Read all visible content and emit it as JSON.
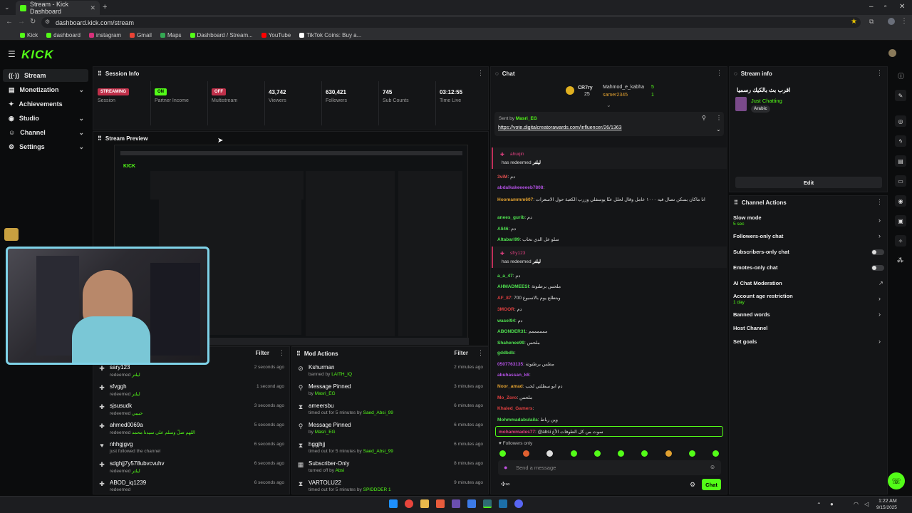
{
  "browser": {
    "tab_title": "Stream - Kick Dashboard",
    "url": "dashboard.kick.com/stream",
    "bookmarks": [
      "Kick",
      "dashboard",
      "instagram",
      "Gmail",
      "Maps",
      "Dashboard / Stream...",
      "YouTube",
      "TikTok Coins: Buy a..."
    ]
  },
  "app": {
    "logo": "KICK"
  },
  "sidebar": {
    "items": [
      {
        "label": "Stream"
      },
      {
        "label": "Monetization"
      },
      {
        "label": "Achievements"
      },
      {
        "label": "Studio"
      },
      {
        "label": "Channel"
      },
      {
        "label": "Settings"
      }
    ]
  },
  "session": {
    "title": "Session Info",
    "stats": [
      {
        "value": "STREAMING",
        "label": "Session"
      },
      {
        "value": "ON",
        "label": "Partner Income"
      },
      {
        "value": "OFF",
        "label": "Multistream"
      },
      {
        "value": "43,742",
        "label": "Viewers"
      },
      {
        "value": "630,421",
        "label": "Followers"
      },
      {
        "value": "745",
        "label": "Sub Counts"
      },
      {
        "value": "03:12:55",
        "label": "Time Live"
      }
    ]
  },
  "preview": {
    "title": "Stream Preview"
  },
  "activity": {
    "filter": "Filter",
    "rows": [
      {
        "name": "sary123",
        "sub": "redeemed",
        "extra": "ليلتر",
        "time": "2 seconds ago"
      },
      {
        "name": "sfvggh",
        "sub": "redeemed",
        "extra": "ليلتر",
        "time": "1 second ago"
      },
      {
        "name": "sjsusudk",
        "sub": "redeemed",
        "extra": "حبيبي",
        "time": "3 seconds ago"
      },
      {
        "name": "ahmed0069a",
        "sub": "redeemed",
        "extra": "اللهم صلّ وسلم على سيدنا محمد",
        "time": "5 seconds ago"
      },
      {
        "name": "nhhgjgvg",
        "sub": "just followed the channel",
        "extra": "",
        "time": "6 seconds ago"
      },
      {
        "name": "sdghjj7y578ubvcvuhv",
        "sub": "redeemed",
        "extra": "ليلتر",
        "time": "6 seconds ago"
      },
      {
        "name": "ABOD_iq1239",
        "sub": "redeemed",
        "extra": "",
        "time": "6 seconds ago"
      }
    ]
  },
  "mod": {
    "title": "Mod Actions",
    "filter": "Filter",
    "rows": [
      {
        "name": "Kshurman",
        "sub": "banned by",
        "by": "LAITH_IQ",
        "time": "2 minutes ago"
      },
      {
        "name": "Message Pinned",
        "sub": "by",
        "by": "Masri_EG",
        "time": "3 minutes ago"
      },
      {
        "name": "ameersbu",
        "sub": "timed out for 5 minutes by",
        "by": "Saed_Absi_99",
        "time": "6 minutes ago"
      },
      {
        "name": "Message Pinned",
        "sub": "by",
        "by": "Masri_EG",
        "time": "6 minutes ago"
      },
      {
        "name": "hggjhjj",
        "sub": "timed out for 5 minutes by",
        "by": "Saed_Absi_99",
        "time": "6 minutes ago"
      },
      {
        "name": "Subscriber-Only",
        "sub": "turned off by",
        "by": "Absi",
        "time": "8 minutes ago"
      },
      {
        "name": "VARTOLU22",
        "sub": "timed out for 5 minutes by",
        "by": "SPIDDDER 1",
        "time": "9 minutes ago"
      }
    ]
  },
  "chat": {
    "title": "Chat",
    "leaders": [
      {
        "name": "CR7ry",
        "value": "25"
      },
      {
        "name": "Mahmod_e_kabha",
        "value": "5"
      },
      {
        "name": "samer2345",
        "value": "1"
      }
    ],
    "pinned_by": "Sent by",
    "pinned_user": "Masri_EG",
    "pinned_link": "https://vote.digitalcreatorawards.com/influencer/26/1363",
    "messages": [
      {
        "user": "3viM",
        "text": "دم",
        "color": "#e05050"
      },
      {
        "user": "abdalkakeeeeeb7808",
        "text": "",
        "color": "#b050e0"
      },
      {
        "user": "Hoomammm607",
        "text": "انا ماكان بسكن نصال فيه ١٠٠٠ عامل وقال لحلل عنّا يوسفلي وزرب الكعبة حول الاسعرات",
        "color": "#e0a030"
      },
      {
        "user": "anees_gurib",
        "text": "دم",
        "color": "#50e050"
      },
      {
        "user": "Ali46",
        "text": "دم",
        "color": "#50e050"
      },
      {
        "user": "Altabari99",
        "text": "سلو عل الدي نحاب",
        "color": "#50e050"
      },
      {
        "user": "a_a_47",
        "text": "دم",
        "color": "#50e050"
      },
      {
        "user": "AHMADMEESI",
        "text": "ملحس برطنوتة",
        "color": "#50e050"
      },
      {
        "user": "AF_87",
        "text": "700 وبتطلع يوم بالاسبوع",
        "color": "#e04040"
      },
      {
        "user": "3MOOR",
        "text": "دم",
        "color": "#e04040"
      },
      {
        "user": "wasel94",
        "text": "دم",
        "color": "#50e050"
      },
      {
        "user": "ABONDER31",
        "text": "ممممممم",
        "color": "#50e050"
      },
      {
        "user": "Shahenee99",
        "text": "ملحس",
        "color": "#50e050"
      },
      {
        "user": "gddbdb",
        "text": "",
        "color": "#50e050"
      },
      {
        "user": "0507763135",
        "text": "مطس برطنوتة",
        "color": "#b050e0"
      },
      {
        "user": "abuhassan_k6",
        "text": "",
        "color": "#b050e0"
      },
      {
        "user": "Noor_amad",
        "text": "دم ابو سطلتي لحب",
        "color": "#e0a030"
      },
      {
        "user": "Mo_Zoro",
        "text": "ملحس",
        "color": "#e04040"
      },
      {
        "user": "Khaled_Gamers",
        "text": "",
        "color": "#e04040"
      },
      {
        "user": "Mohmmadabulaila",
        "text": "وين رباط",
        "color": "#50e050"
      }
    ],
    "redeems": [
      {
        "user": "ahuqin",
        "text": "has redeemed",
        "reward": "ليلتر"
      },
      {
        "user": "sfry123",
        "text": "has redeemed",
        "reward": "ليلتر"
      }
    ],
    "reply": {
      "user": "mohammades77",
      "text": "@absi سوت من كل الطوفات الأغ"
    },
    "followers_only": "Followers only",
    "input_placeholder": "Send a message",
    "send_label": "Chat"
  },
  "stream_info": {
    "title": "Stream info",
    "stream_title": "اقرب بث بالكيك رسميا",
    "category": "Just Chatting",
    "language": "Arabic",
    "edit_label": "Edit"
  },
  "channel_actions": {
    "title": "Channel Actions",
    "items": [
      {
        "label": "Slow mode",
        "sub": "5 sec"
      },
      {
        "label": "Followers-only chat",
        "sub": ""
      },
      {
        "label": "Subscribers-only chat",
        "sub": ""
      },
      {
        "label": "Emotes-only chat",
        "sub": ""
      },
      {
        "label": "AI Chat Moderation",
        "sub": ""
      },
      {
        "label": "Account age restriction",
        "sub": "1 day"
      },
      {
        "label": "Banned words",
        "sub": ""
      },
      {
        "label": "Host Channel",
        "sub": ""
      },
      {
        "label": "Set goals",
        "sub": ""
      }
    ]
  },
  "taskbar": {
    "time": "1:22 AM",
    "date": "9/15/2025"
  },
  "colors": {
    "accent": "#53fc18",
    "live_red": "#c0304a",
    "bg": "#0b0c0d",
    "panel": "#141517"
  }
}
